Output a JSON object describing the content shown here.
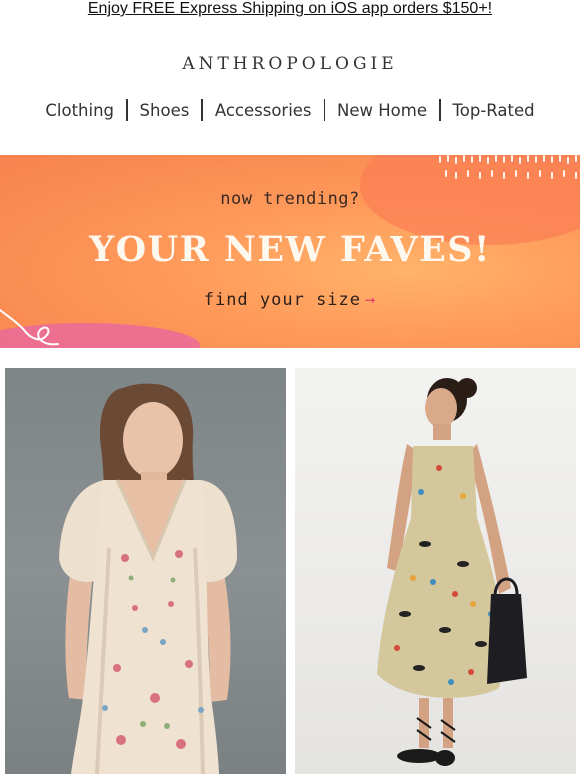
{
  "promo": {
    "text": "Enjoy FREE Express Shipping on iOS app orders $150+!"
  },
  "brand": {
    "logo": "ANTHROPOLOGIE"
  },
  "nav": {
    "items": [
      {
        "label": "Clothing"
      },
      {
        "label": "Shoes"
      },
      {
        "label": "Accessories"
      },
      {
        "label": "New Home"
      },
      {
        "label": "Top-Rated"
      }
    ]
  },
  "hero": {
    "eyebrow": "now trending?",
    "title": "YOUR NEW FAVES!",
    "cta": "find your size",
    "cta_arrow": "→",
    "colors": {
      "background": "#f98a52",
      "accent_pink": "#ea6a9a",
      "arrow": "#e8426a"
    }
  },
  "products": [
    {
      "image": "embroidered-linen-mini-dress-photo"
    },
    {
      "image": "printed-midi-slip-dress-photo"
    }
  ]
}
